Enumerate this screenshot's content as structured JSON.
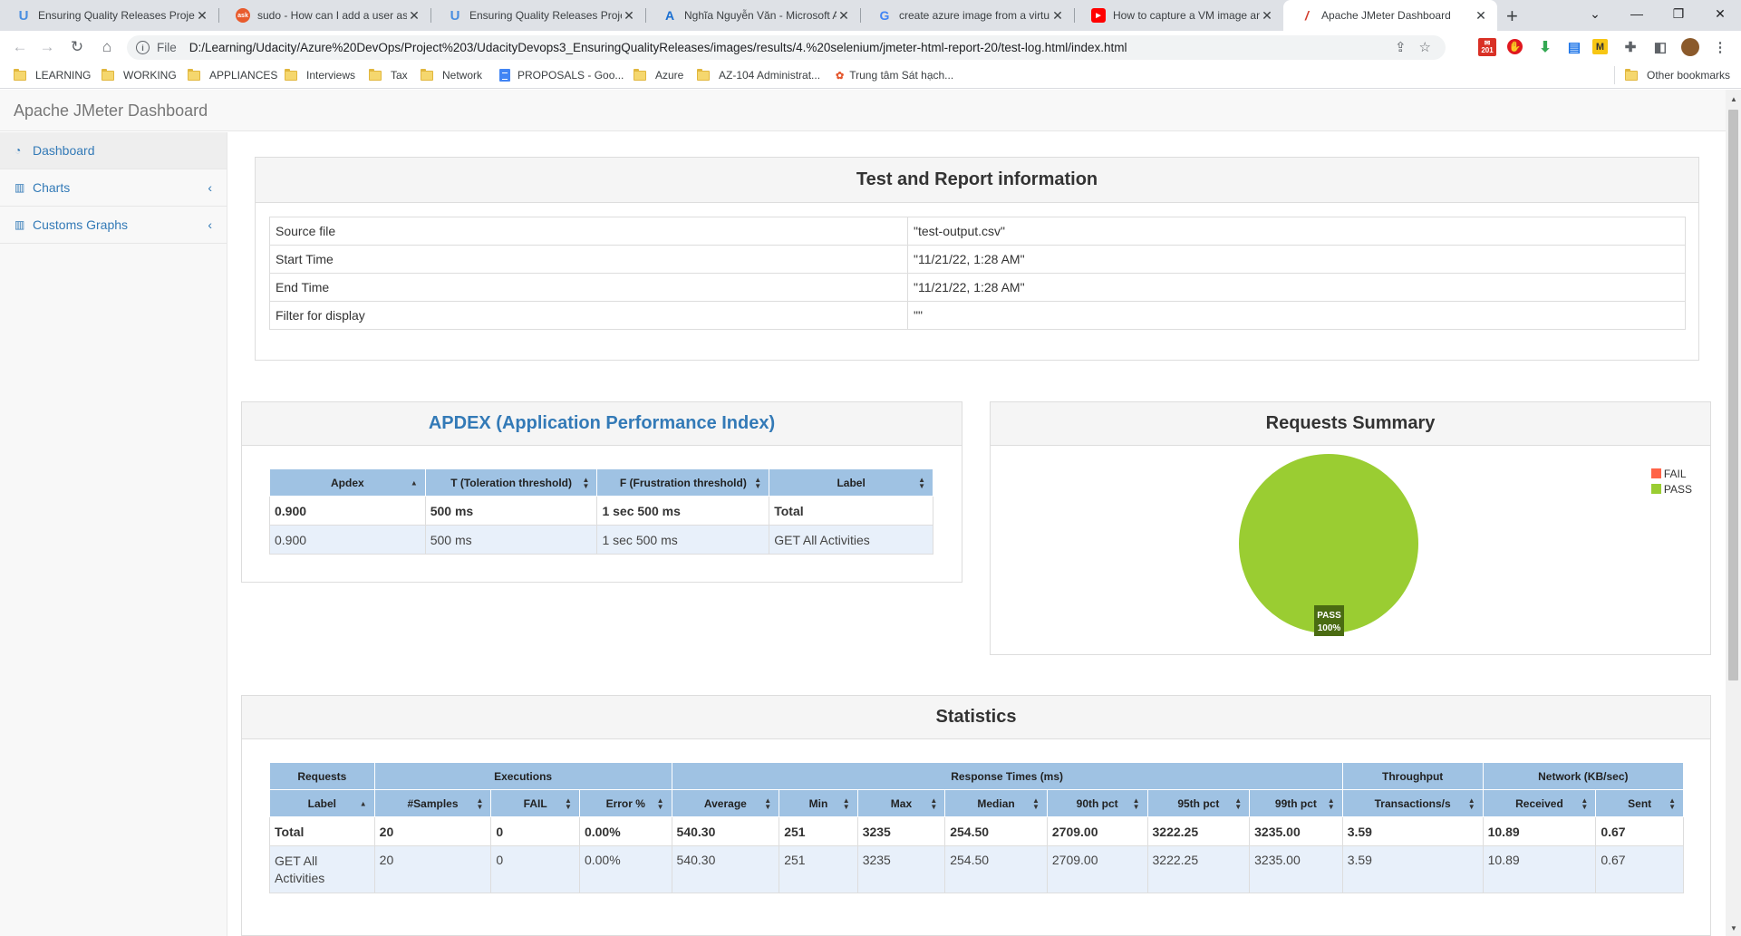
{
  "browser": {
    "tabs": [
      {
        "title": "Ensuring Quality Releases Projec",
        "icon": "udacity-icon",
        "active": false
      },
      {
        "title": "sudo - How can I add a user as a",
        "icon": "askubuntu-icon",
        "active": false
      },
      {
        "title": "Ensuring Quality Releases Projec",
        "icon": "udacity-icon",
        "active": false
      },
      {
        "title": "Nghĩa Nguyễn Văn - Microsoft A",
        "icon": "azure-icon",
        "active": false
      },
      {
        "title": "create azure image from a virtu",
        "icon": "google-icon",
        "active": false
      },
      {
        "title": "How to capture a VM image and",
        "icon": "youtube-icon",
        "active": false
      },
      {
        "title": "Apache JMeter Dashboard",
        "icon": "jmeter-icon",
        "active": true
      }
    ],
    "address_scheme": "File",
    "address_url": "D:/Learning/Udacity/Azure%20DevOps/Project%203/UdacityDevops3_EnsuringQualityReleases/images/results/4.%20selenium/jmeter-html-report-20/test-log.html/index.html",
    "extension_badge": "201",
    "bookmarks": [
      {
        "label": "LEARNING",
        "type": "folder"
      },
      {
        "label": "WORKING",
        "type": "folder"
      },
      {
        "label": "APPLIANCES",
        "type": "folder"
      },
      {
        "label": "Interviews",
        "type": "folder"
      },
      {
        "label": "Tax",
        "type": "folder"
      },
      {
        "label": "Network",
        "type": "folder"
      },
      {
        "label": "PROPOSALS - Goo...",
        "type": "doc"
      },
      {
        "label": "Azure",
        "type": "folder"
      },
      {
        "label": "AZ-104 Administrat...",
        "type": "folder"
      },
      {
        "label": "Trung tâm Sát hạch...",
        "type": "site"
      }
    ],
    "other_bookmarks": "Other bookmarks"
  },
  "app": {
    "brand": "Apache JMeter Dashboard",
    "sidebar": [
      {
        "label": "Dashboard",
        "icon": "dashboard-icon",
        "active": true,
        "expandable": false
      },
      {
        "label": "Charts",
        "icon": "bar-chart-icon",
        "active": false,
        "expandable": true
      },
      {
        "label": "Customs Graphs",
        "icon": "bar-chart-icon",
        "active": false,
        "expandable": true
      }
    ]
  },
  "report_info": {
    "title": "Test and Report information",
    "rows": [
      {
        "key": "Source file",
        "value": "\"test-output.csv\""
      },
      {
        "key": "Start Time",
        "value": "\"11/21/22, 1:28 AM\""
      },
      {
        "key": "End Time",
        "value": "\"11/21/22, 1:28 AM\""
      },
      {
        "key": "Filter for display",
        "value": "\"\""
      }
    ]
  },
  "apdex": {
    "title": "APDEX (Application Performance Index)",
    "headers": [
      "Apdex",
      "T (Toleration threshold)",
      "F (Frustration threshold)",
      "Label"
    ],
    "rows": [
      [
        "0.900",
        "500 ms",
        "1 sec 500 ms",
        "Total"
      ],
      [
        "0.900",
        "500 ms",
        "1 sec 500 ms",
        "GET All Activities"
      ]
    ]
  },
  "requests_summary": {
    "title": "Requests Summary",
    "legend": [
      {
        "label": "FAIL",
        "color": "#ff6347"
      },
      {
        "label": "PASS",
        "color": "#9acd32"
      }
    ],
    "slice_label": "PASS",
    "slice_pct": "100%"
  },
  "chart_data": {
    "type": "pie",
    "categories": [
      "FAIL",
      "PASS"
    ],
    "values": [
      0,
      100
    ],
    "colors": [
      "#ff6347",
      "#9acd32"
    ],
    "title": "Requests Summary",
    "legend_position": "top-right"
  },
  "statistics": {
    "title": "Statistics",
    "groups": [
      {
        "label": "Requests",
        "span": 1
      },
      {
        "label": "Executions",
        "span": 3
      },
      {
        "label": "Response Times (ms)",
        "span": 7
      },
      {
        "label": "Throughput",
        "span": 1
      },
      {
        "label": "Network (KB/sec)",
        "span": 2
      }
    ],
    "headers": [
      "Label",
      "#Samples",
      "FAIL",
      "Error %",
      "Average",
      "Min",
      "Max",
      "Median",
      "90th pct",
      "95th pct",
      "99th pct",
      "Transactions/s",
      "Received",
      "Sent"
    ],
    "rows": [
      [
        "Total",
        "20",
        "0",
        "0.00%",
        "540.30",
        "251",
        "3235",
        "254.50",
        "2709.00",
        "3222.25",
        "3235.00",
        "3.59",
        "10.89",
        "0.67"
      ],
      [
        "GET All Activities",
        "20",
        "0",
        "0.00%",
        "540.30",
        "251",
        "3235",
        "254.50",
        "2709.00",
        "3222.25",
        "3235.00",
        "3.59",
        "10.89",
        "0.67"
      ]
    ]
  }
}
